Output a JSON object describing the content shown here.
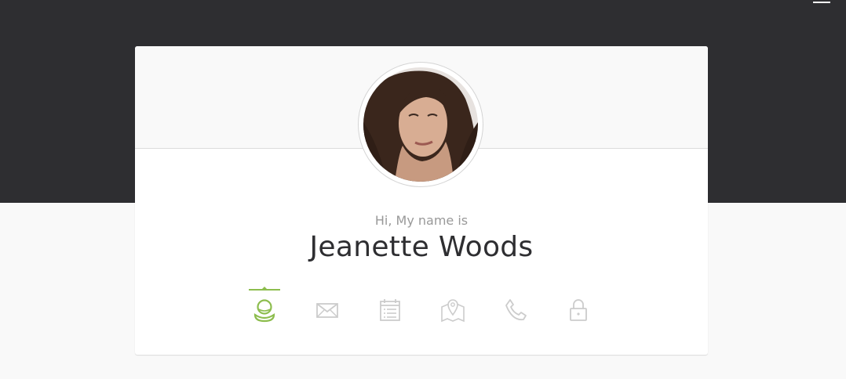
{
  "profile": {
    "greeting": "Hi, My name is",
    "name": "Jeanette Woods"
  },
  "tabs": [
    {
      "icon": "user-icon",
      "active": true
    },
    {
      "icon": "envelope-icon",
      "active": false
    },
    {
      "icon": "calendar-icon",
      "active": false
    },
    {
      "icon": "map-icon",
      "active": false
    },
    {
      "icon": "phone-icon",
      "active": false
    },
    {
      "icon": "lock-icon",
      "active": false
    }
  ],
  "colors": {
    "dark_band": "#2e2e31",
    "accent": "#8dbd4e",
    "icon_inactive": "#cccccc",
    "greeting_text": "#999999",
    "name_text": "#2e2e31"
  }
}
